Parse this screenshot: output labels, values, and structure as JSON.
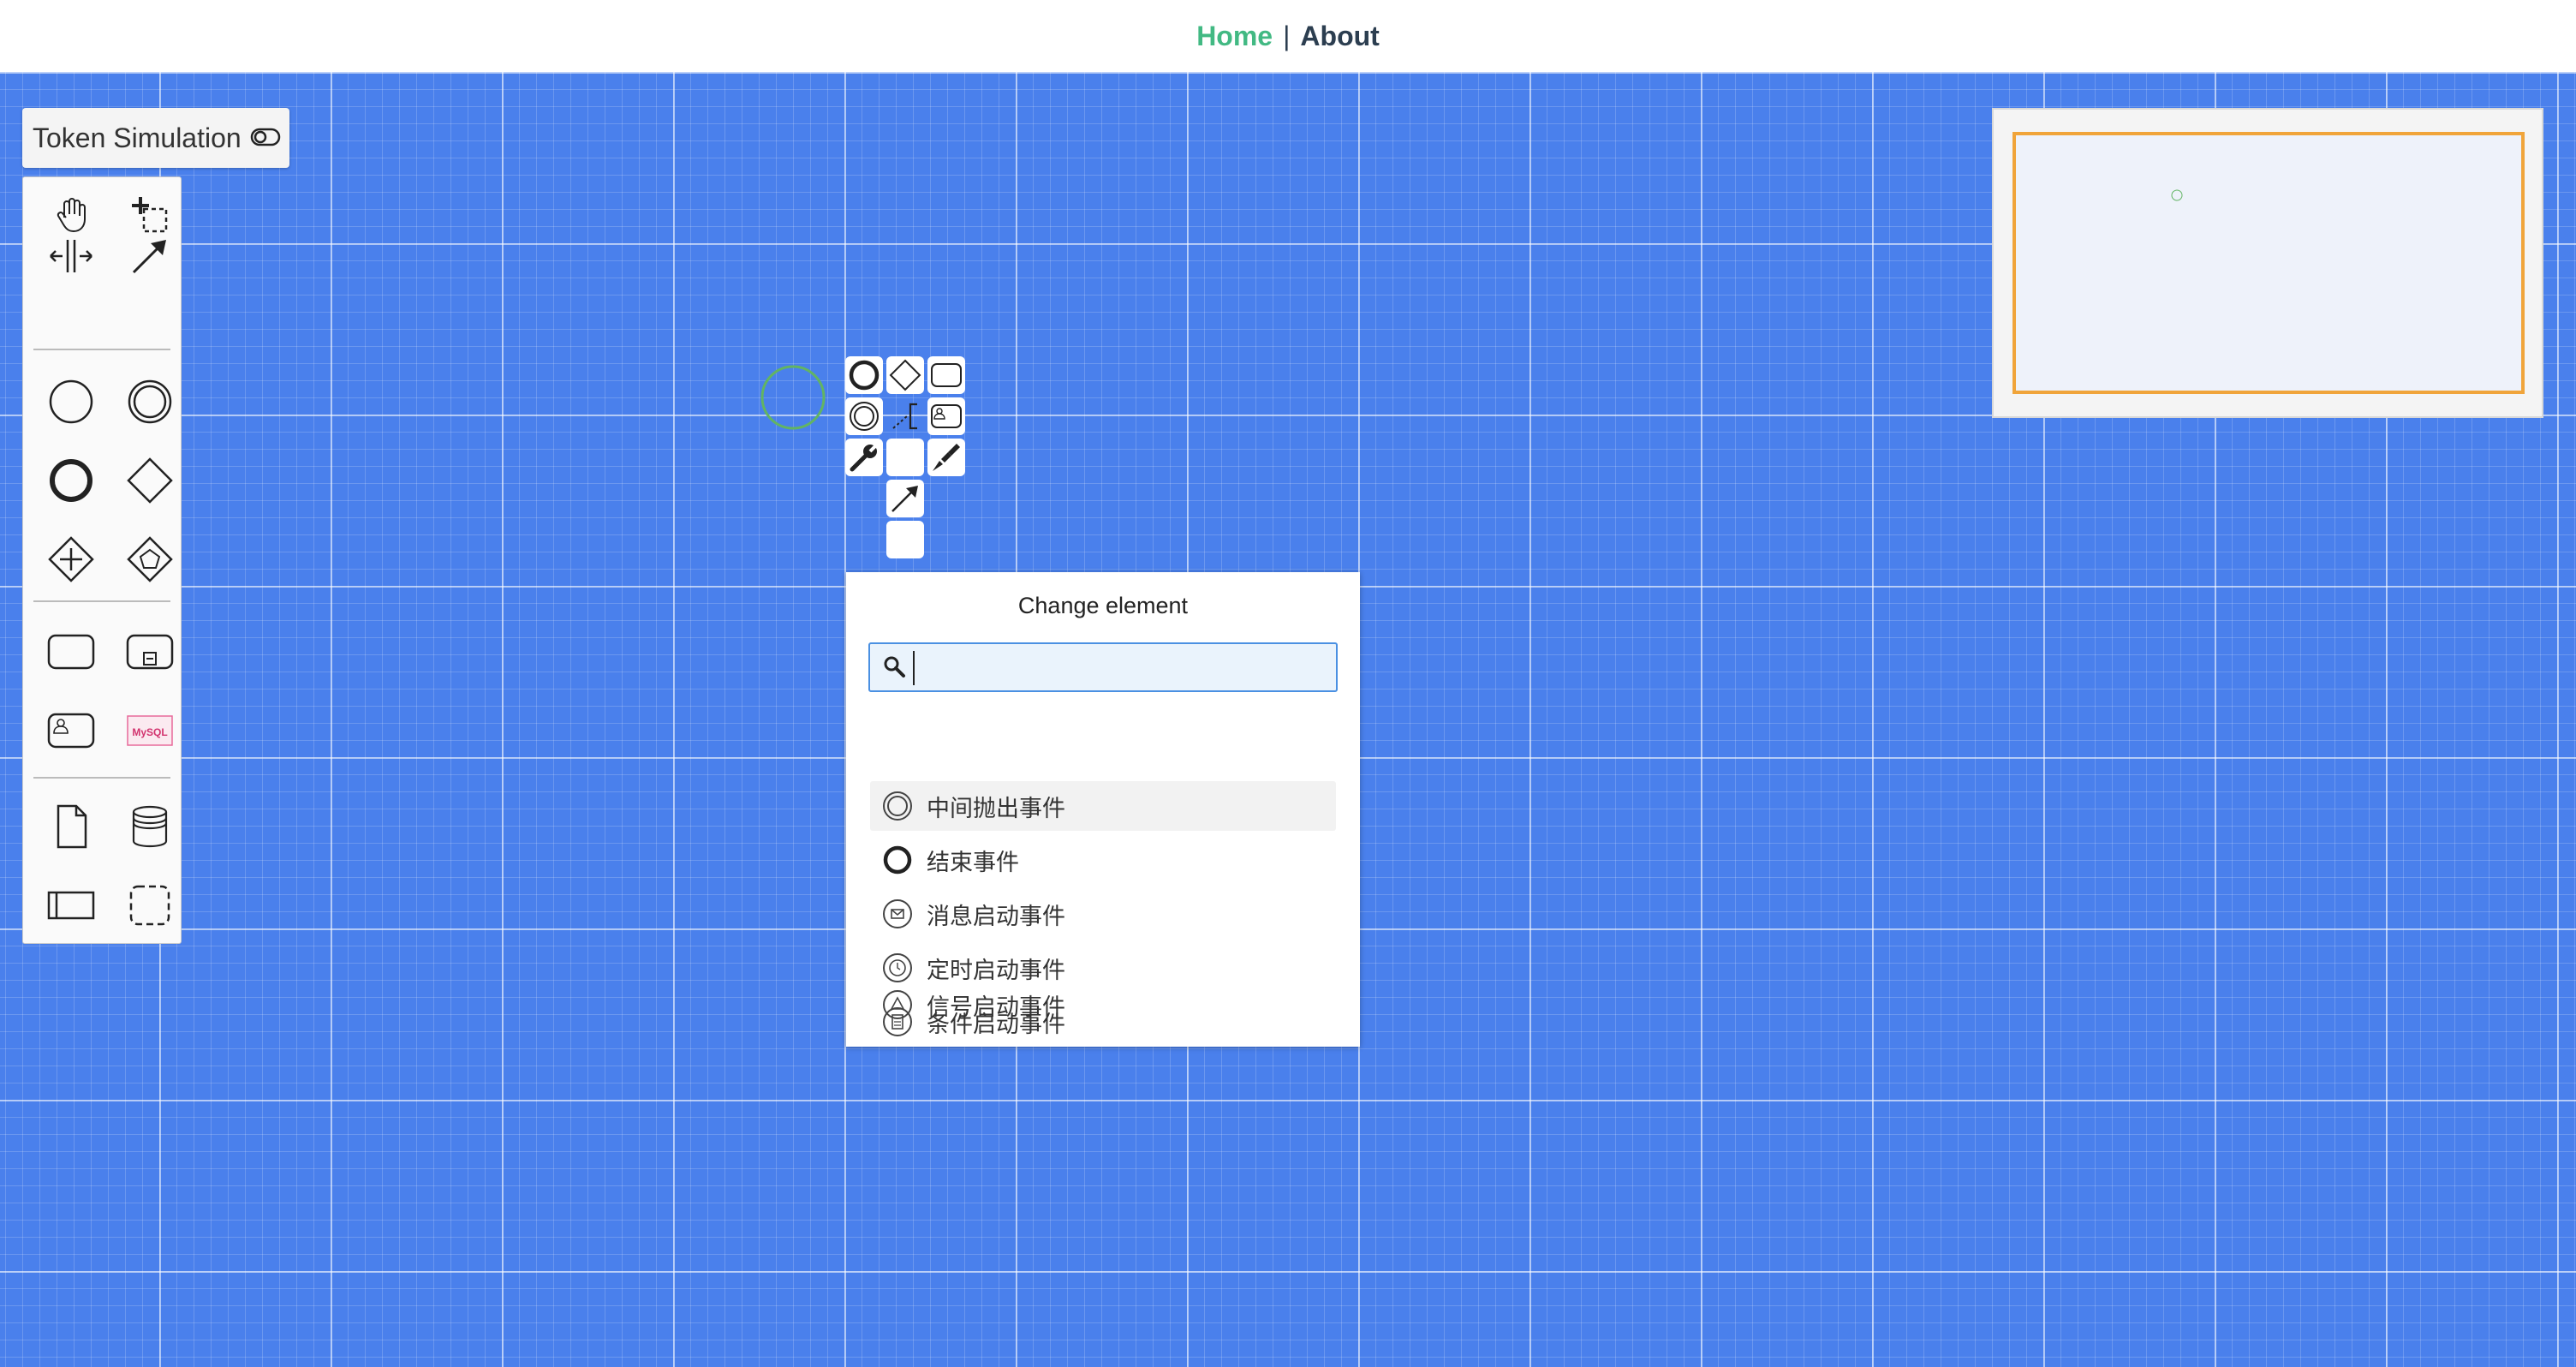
{
  "nav": {
    "home_label": "Home",
    "separator": "|",
    "about_label": "About",
    "home_color": "#42b983",
    "about_color": "#2c3e50"
  },
  "canvas": {
    "background_color": "#4a80ec",
    "grid": true
  },
  "token_simulation": {
    "label": "Token Simulation",
    "icon": "toggle-off-icon"
  },
  "palette": {
    "tools": [
      {
        "name": "hand-tool",
        "icon": "hand-icon"
      },
      {
        "name": "lasso-tool",
        "icon": "lasso-icon"
      },
      {
        "name": "space-tool",
        "icon": "space-tool-icon"
      },
      {
        "name": "global-connect-tool",
        "icon": "connect-arrow-icon"
      }
    ],
    "shapes": [
      {
        "name": "start-event",
        "icon": "start-event-icon"
      },
      {
        "name": "intermediate-event",
        "icon": "intermediate-event-icon"
      },
      {
        "name": "end-event",
        "icon": "end-event-icon"
      },
      {
        "name": "gateway",
        "icon": "gateway-icon"
      },
      {
        "name": "parallel-gateway",
        "icon": "parallel-gateway-icon"
      },
      {
        "name": "event-based-gateway",
        "icon": "event-gateway-icon"
      },
      {
        "name": "task",
        "icon": "task-icon"
      },
      {
        "name": "subprocess",
        "icon": "subprocess-icon"
      },
      {
        "name": "user-task",
        "icon": "user-task-icon"
      },
      {
        "name": "mysql-task",
        "icon": "mysql-icon",
        "text": "MySQL"
      },
      {
        "name": "data-object",
        "icon": "data-object-icon"
      },
      {
        "name": "data-store",
        "icon": "data-store-icon"
      },
      {
        "name": "participant",
        "icon": "pool-icon"
      },
      {
        "name": "group",
        "icon": "group-icon"
      }
    ]
  },
  "context_pad": [
    {
      "name": "append-end-event",
      "icon": "end-event-icon"
    },
    {
      "name": "append-gateway",
      "icon": "gateway-icon"
    },
    {
      "name": "append-task",
      "icon": "task-icon"
    },
    {
      "name": "append-intermediate-event",
      "icon": "intermediate-event-icon"
    },
    {
      "name": "append-text-annotation",
      "icon": "text-annotation-icon"
    },
    {
      "name": "append-user-task",
      "icon": "user-task-icon"
    },
    {
      "name": "replace",
      "icon": "wrench-icon"
    },
    {
      "name": "empty-slot",
      "icon": ""
    },
    {
      "name": "color",
      "icon": "paint-brush-icon"
    },
    {
      "name": "connect",
      "icon": "connect-arrow-icon"
    },
    {
      "name": "empty-slot-2",
      "icon": ""
    }
  ],
  "popup": {
    "title": "Change element",
    "search": {
      "value": "",
      "placeholder": ""
    },
    "entries": [
      {
        "label": "中间抛出事件",
        "icon": "intermediate-throw-event-icon",
        "active": true
      },
      {
        "label": "结束事件",
        "icon": "end-event-icon",
        "active": false
      },
      {
        "label": "消息启动事件",
        "icon": "message-start-event-icon",
        "active": false
      },
      {
        "label": "定时启动事件",
        "icon": "timer-start-event-icon",
        "active": false
      },
      {
        "label": "条件启动事件",
        "icon": "conditional-start-event-icon",
        "active": false
      },
      {
        "label": "信号启动事件",
        "icon": "signal-start-event-icon",
        "active": false
      }
    ]
  },
  "minimap": {
    "viewport_color": "#f0a43a"
  }
}
